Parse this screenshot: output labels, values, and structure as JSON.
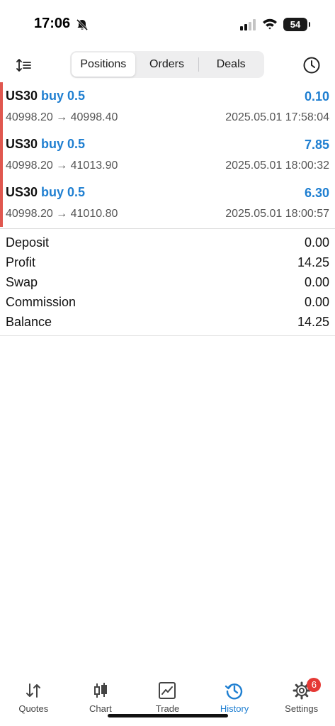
{
  "status": {
    "time": "17:06",
    "battery": "54"
  },
  "toolbar": {
    "tabs": [
      "Positions",
      "Orders",
      "Deals"
    ],
    "active_tab": "Positions"
  },
  "trades": [
    {
      "symbol": "US30",
      "type": "buy 0.5",
      "profit": "0.10",
      "prices": "40998.20 → 40998.40",
      "time": "2025.05.01 17:58:04"
    },
    {
      "symbol": "US30",
      "type": "buy 0.5",
      "profit": "7.85",
      "prices": "40998.20 → 41013.90",
      "time": "2025.05.01 18:00:32"
    },
    {
      "symbol": "US30",
      "type": "buy 0.5",
      "profit": "6.30",
      "prices": "40998.20 → 41010.80",
      "time": "2025.05.01 18:00:57"
    }
  ],
  "summary": [
    {
      "label": "Deposit",
      "value": "0.00"
    },
    {
      "label": "Profit",
      "value": "14.25"
    },
    {
      "label": "Swap",
      "value": "0.00"
    },
    {
      "label": "Commission",
      "value": "0.00"
    },
    {
      "label": "Balance",
      "value": "14.25"
    }
  ],
  "tabbar": {
    "items": [
      {
        "label": "Quotes",
        "icon": "quotes-arrows-icon"
      },
      {
        "label": "Chart",
        "icon": "candlestick-icon"
      },
      {
        "label": "Trade",
        "icon": "trade-chart-icon"
      },
      {
        "label": "History",
        "icon": "history-icon"
      },
      {
        "label": "Settings",
        "icon": "gear-icon"
      }
    ],
    "active": "History",
    "settings_badge": "6"
  },
  "colors": {
    "accent": "#1f7fd1",
    "buy_marker": "#e0574f",
    "badge": "#e53935"
  }
}
